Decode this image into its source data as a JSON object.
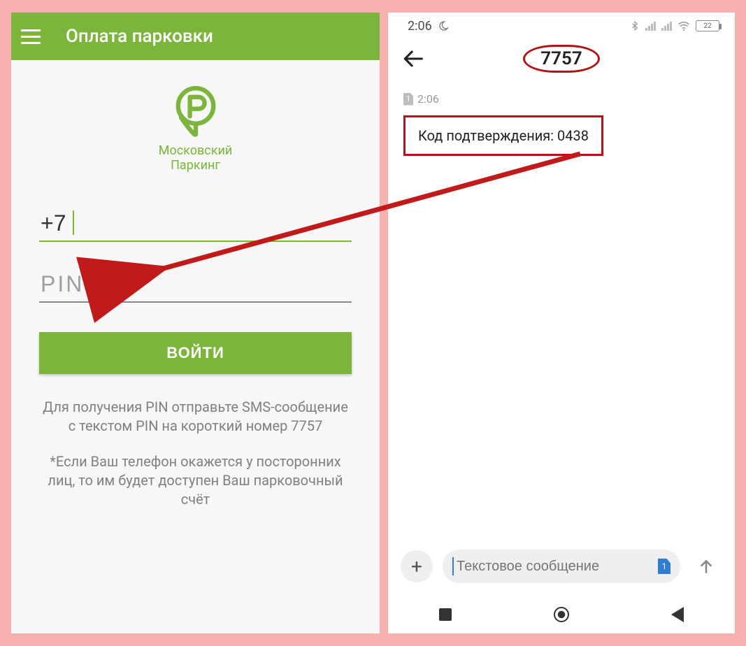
{
  "left": {
    "appbar": {
      "title": "Оплата парковки"
    },
    "logo": {
      "line1": "Московский",
      "line2": "Паркинг"
    },
    "phone_field": {
      "value": "+7"
    },
    "pin_field": {
      "placeholder": "PIN"
    },
    "login_button": "ВОЙТИ",
    "hint1": "Для получения PIN отправьте SMS-сообщение с текстом PIN на короткий номер 7757",
    "hint2": "*Если Ваш телефон окажется у посторонних лиц, то им будет доступен Ваш парковочный счёт"
  },
  "right": {
    "statusbar": {
      "time": "2:06",
      "battery": "22"
    },
    "contact": "7757",
    "message": {
      "time": "2:06",
      "text": "Код подтверждения: 0438"
    },
    "composer": {
      "placeholder": "Текстовое сообщение",
      "sim": "1"
    }
  }
}
